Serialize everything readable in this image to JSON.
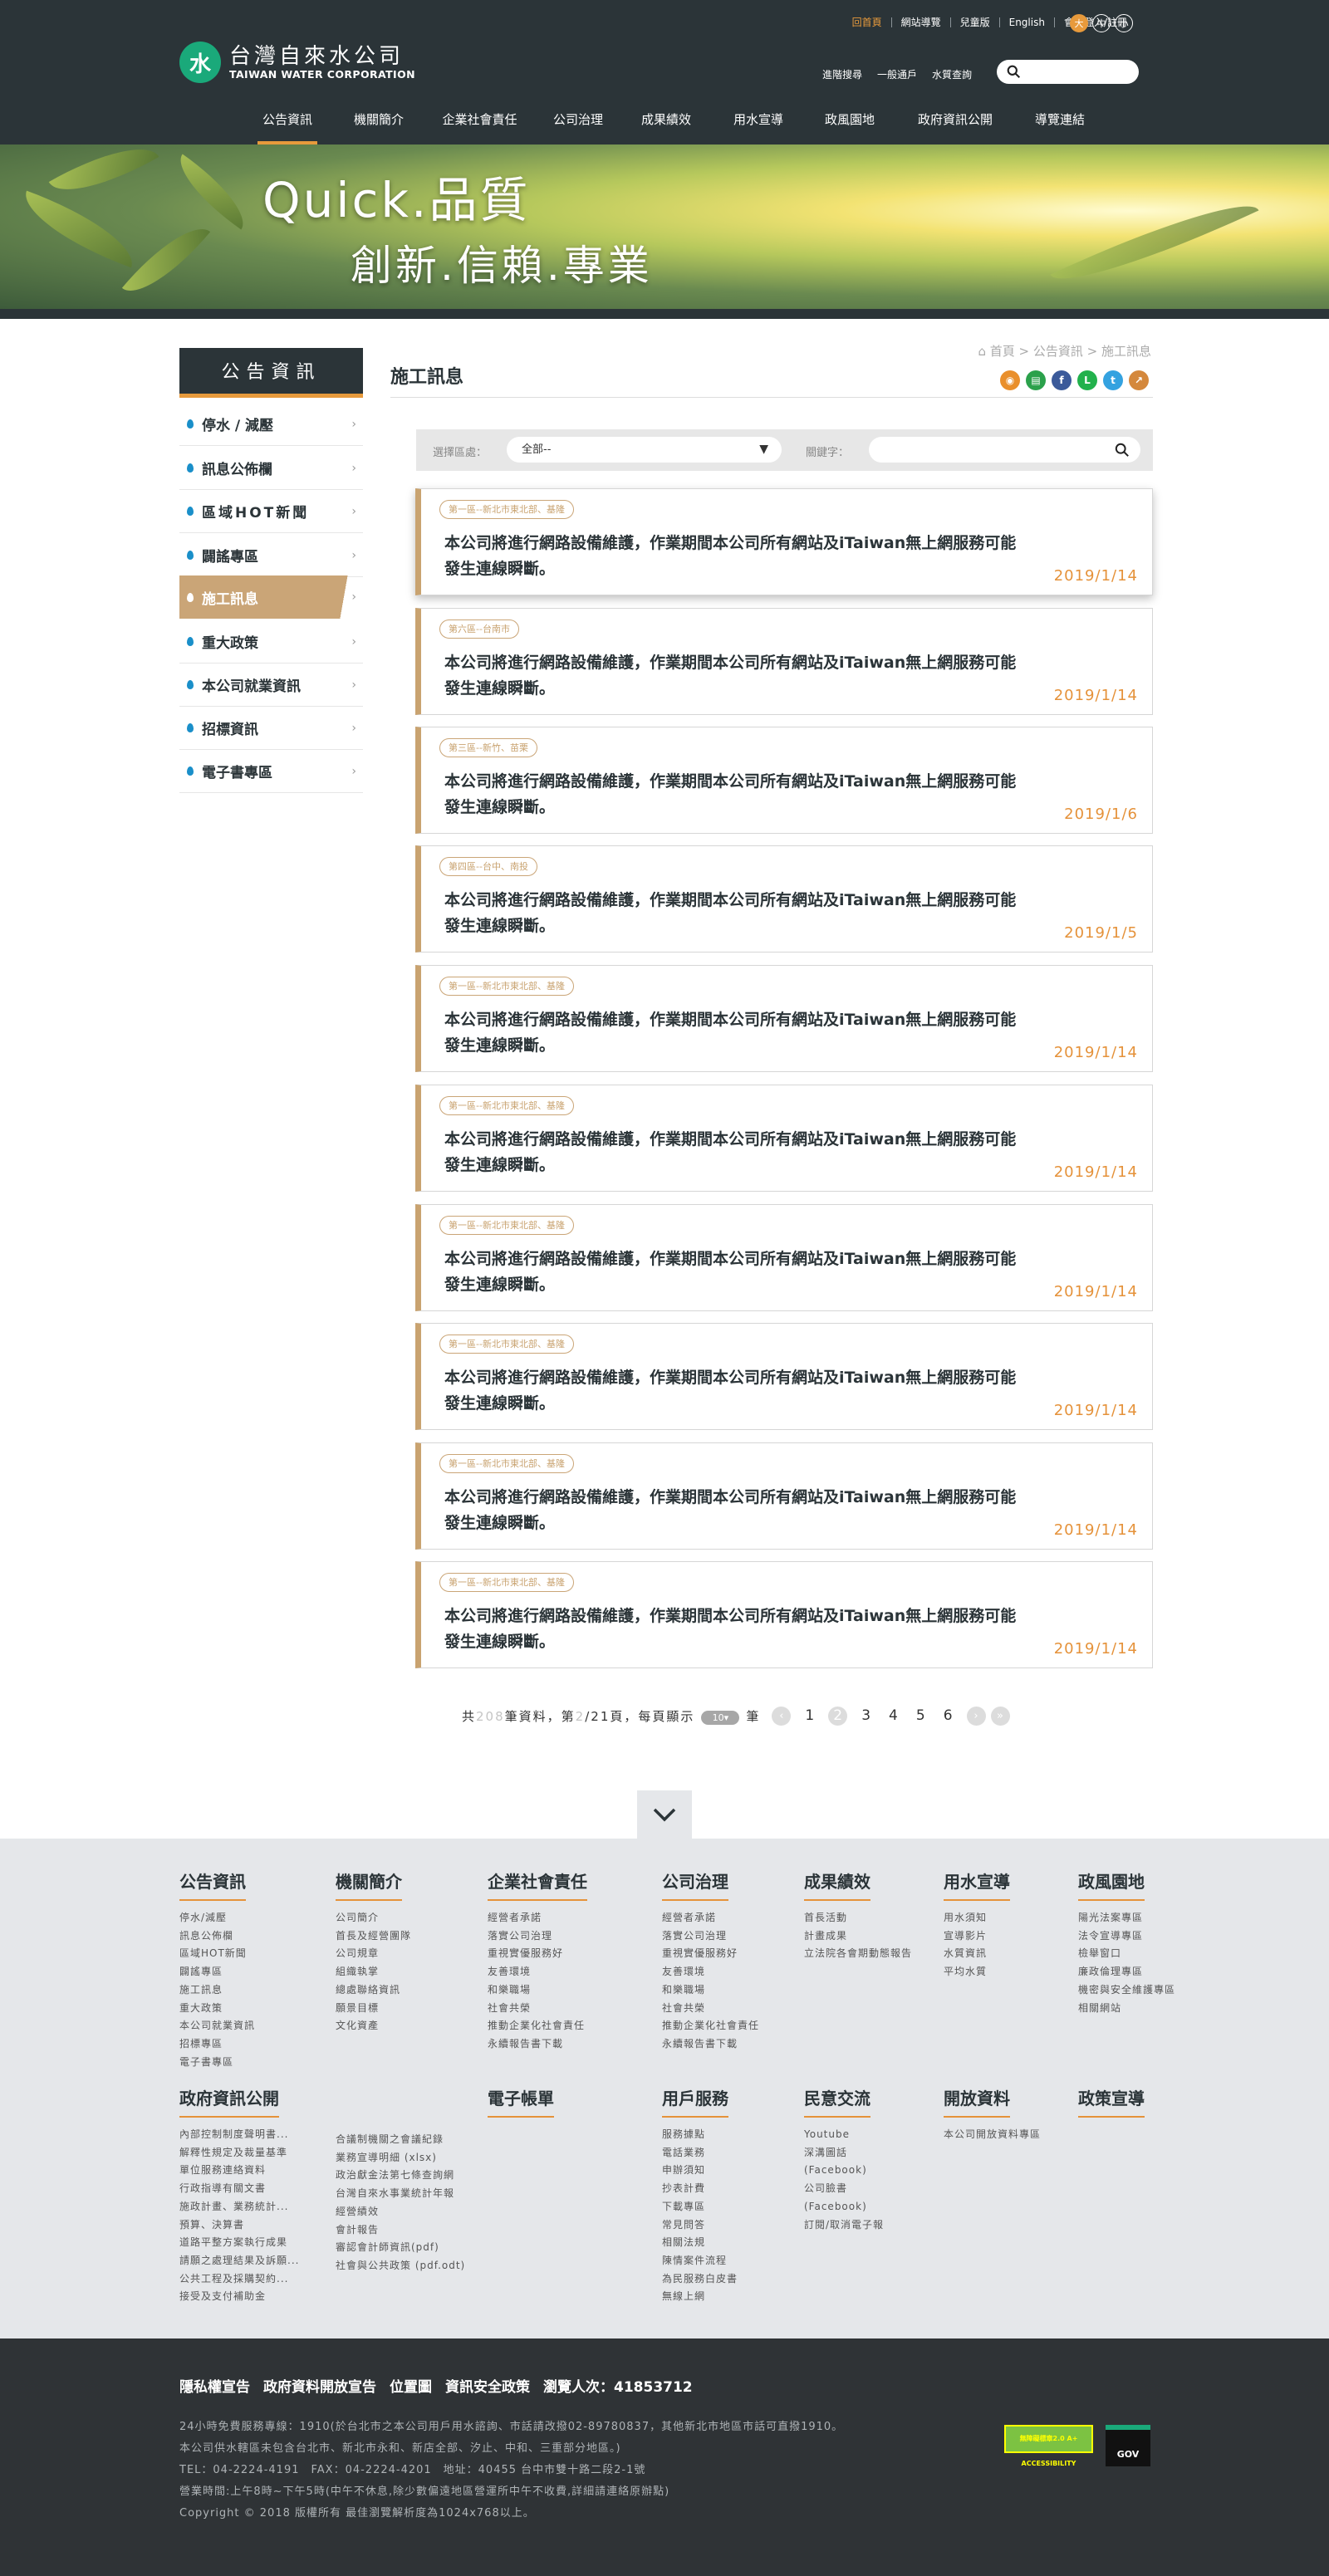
{
  "header": {
    "logo_zh": "台灣自來水公司",
    "logo_en": "TAIWAN WATER CORPORATION",
    "top_links": [
      "回首頁",
      "網站導覽",
      "兒童版",
      "English",
      "會員登入/註冊"
    ],
    "font_sizes": [
      "大",
      "中",
      "小"
    ],
    "sub_links": [
      "進階搜尋",
      "一般通戶",
      "水質查詢"
    ],
    "search_placeholder": ""
  },
  "nav": [
    "公告資訊",
    "機關簡介",
    "企業社會責任",
    "公司治理",
    "成果績效",
    "用水宣導",
    "政風園地",
    "政府資訊公開",
    "導覽連結"
  ],
  "banner": {
    "line1": "Quick.品質",
    "line2": "創新.信賴.專業"
  },
  "sidebar": {
    "title": "公告資訊",
    "items": [
      "停水 / 減壓",
      "訊息公佈欄",
      "區域HOT新聞",
      "闢謠專區",
      "施工訊息",
      "重大政策",
      "本公司就業資訊",
      "招標資訊",
      "電子書專區"
    ],
    "active_index": 4
  },
  "page": {
    "title": "施工訊息",
    "breadcrumb": "首頁 > 公告資訊 > 施工訊息",
    "share_icons": [
      "rss-icon",
      "print-icon",
      "facebook-icon",
      "line-icon",
      "twitter-icon",
      "share-icon"
    ]
  },
  "filter": {
    "region_label": "選擇區處：",
    "region_value": "全部--",
    "keyword_label": "關鍵字：",
    "keyword_value": ""
  },
  "notices": [
    {
      "tag": "第一區--新北市東北部、基隆",
      "text": "本公司將進行網路設備維護，作業期間本公司所有網站及iTaiwan無上網服務可能發生連線瞬斷。",
      "date": "2019/1/14"
    },
    {
      "tag": "第六區--台南市",
      "text": "本公司將進行網路設備維護，作業期間本公司所有網站及iTaiwan無上網服務可能發生連線瞬斷。",
      "date": "2019/1/14"
    },
    {
      "tag": "第三區--新竹、苗栗",
      "text": "本公司將進行網路設備維護，作業期間本公司所有網站及iTaiwan無上網服務可能發生連線瞬斷。",
      "date": "2019/1/6"
    },
    {
      "tag": "第四區--台中、南投",
      "text": "本公司將進行網路設備維護，作業期間本公司所有網站及iTaiwan無上網服務可能發生連線瞬斷。",
      "date": "2019/1/5"
    },
    {
      "tag": "第一區--新北市東北部、基隆",
      "text": "本公司將進行網路設備維護，作業期間本公司所有網站及iTaiwan無上網服務可能發生連線瞬斷。",
      "date": "2019/1/14"
    },
    {
      "tag": "第一區--新北市東北部、基隆",
      "text": "本公司將進行網路設備維護，作業期間本公司所有網站及iTaiwan無上網服務可能發生連線瞬斷。",
      "date": "2019/1/14"
    },
    {
      "tag": "第一區--新北市東北部、基隆",
      "text": "本公司將進行網路設備維護，作業期間本公司所有網站及iTaiwan無上網服務可能發生連線瞬斷。",
      "date": "2019/1/14"
    },
    {
      "tag": "第一區--新北市東北部、基隆",
      "text": "本公司將進行網路設備維護，作業期間本公司所有網站及iTaiwan無上網服務可能發生連線瞬斷。",
      "date": "2019/1/14"
    },
    {
      "tag": "第一區--新北市東北部、基隆",
      "text": "本公司將進行網路設備維護，作業期間本公司所有網站及iTaiwan無上網服務可能發生連線瞬斷。",
      "date": "2019/1/14"
    },
    {
      "tag": "第一區--新北市東北部、基隆",
      "text": "本公司將進行網路設備維護，作業期間本公司所有網站及iTaiwan無上網服務可能發生連線瞬斷。",
      "date": "2019/1/14"
    }
  ],
  "pager": {
    "prefix": "共",
    "total": "208",
    "mid1": "筆資料，第",
    "current": "2",
    "mid2": "/21頁，每頁顯示",
    "per_page": "10",
    "suffix": "筆",
    "pages": [
      "1",
      "2",
      "3",
      "4",
      "5",
      "6"
    ],
    "current_page_index": 1
  },
  "footer": {
    "columns": [
      {
        "title": "公告資訊",
        "items": [
          "停水/減壓",
          "訊息公佈欄",
          "區域HOT新聞",
          "闢謠專區",
          "施工訊息",
          "重大政策",
          "本公司就業資訊",
          "招標專區",
          "電子書專區"
        ]
      },
      {
        "title": "機關簡介",
        "items": [
          "公司簡介",
          "首長及經營團隊",
          "公司規章",
          "組織執掌",
          "總處聯絡資訊",
          "願景目標",
          "文化資產"
        ]
      },
      {
        "title": "企業社會責任",
        "items": [
          "經營者承諾",
          "落實公司治理",
          "重視實優服務好",
          "友善環境",
          "和樂職場",
          "社會共榮",
          "推動企業化社會責任",
          "永續報告書下載"
        ]
      },
      {
        "title": "公司治理",
        "items": [
          "經營者承諾",
          "落實公司治理",
          "重視實優服務好",
          "友善環境",
          "和樂職場",
          "社會共榮",
          "推動企業化社會責任",
          "永續報告書下載"
        ]
      },
      {
        "title": "成果績效",
        "items": [
          "首長活動",
          "計畫成果",
          "立法院各會期動態報告"
        ]
      },
      {
        "title": "用水宣導",
        "items": [
          "用水須知",
          "宣導影片",
          "水質資訊",
          "平均水質"
        ]
      },
      {
        "title": "政風園地",
        "items": [
          "陽光法案專區",
          "法令宣導專區",
          "檢舉窗口",
          "廉政倫理專區",
          "機密與安全維護專區",
          "相關網站"
        ]
      },
      {
        "title": "政府資訊公開",
        "items": [
          "內部控制制度聲明書...",
          "解釋性規定及裁量基準",
          "單位服務連絡資料",
          "行政指導有關文書",
          "施政計畫、業務統計...",
          "預算、決算書",
          "道路平整方案執行成果",
          "請願之處理結果及訴願...",
          "公共工程及採購契約...",
          "接受及支付補助金"
        ]
      },
      {
        "title": "",
        "items": [
          "合議制機關之會議紀錄",
          "業務宣導明細 (xlsx)",
          "政治獻金法第七條查詢網",
          "台灣自來水事業統計年報",
          "經營績效",
          "會計報告",
          "審認會計師資訊(pdf)",
          "社會與公共政策 (pdf.odt)"
        ]
      },
      {
        "title": "電子帳單",
        "items": []
      },
      {
        "title": "用戶服務",
        "items": [
          "服務據點",
          "電話業務",
          "申辦須知",
          "抄表計費",
          "下載專區",
          "常見問答",
          "相關法規",
          "陳情案件流程",
          "為民服務白皮書",
          "無線上網"
        ]
      },
      {
        "title": "民意交流",
        "items": [
          "Youtube",
          "深溝圖話",
          "(Facebook)",
          "公司臉書",
          "(Facebook)",
          "訂閱/取消電子報"
        ]
      },
      {
        "title": "開放資料",
        "items": [
          "本公司開放資料專區"
        ]
      },
      {
        "title": "政策宣導",
        "items": []
      }
    ],
    "bar_links": [
      "隱私權宣告",
      "政府資料開放宣告",
      "位置圖",
      "資訊安全政策",
      "瀏覽人次：41853712"
    ],
    "info_lines": [
      "24小時免費服務專線：1910(於台北市之本公司用戶用水諮詢、市話請改撥02-89780837，其他新北市地區市話可直撥1910。",
      "本公司供水轄區未包含台北市、新北市永和、新店全部、汐止、中和、三重部分地區。)",
      "TEL：04-2224-4191　FAX：04-2224-4201　地址：40455 台中市雙十路二段2-1號",
      "營業時間:上午8時~下午5時(中午不休息,除少數偏遠地區營運所中午不收費,詳細請連絡原辦點)",
      "Copyright © 2018 版權所有 最佳瀏覽解析度為1024x768以上。"
    ],
    "badges": [
      "無障礙標章2.0 A+ ACCESSIBILITY",
      "GOV"
    ]
  }
}
